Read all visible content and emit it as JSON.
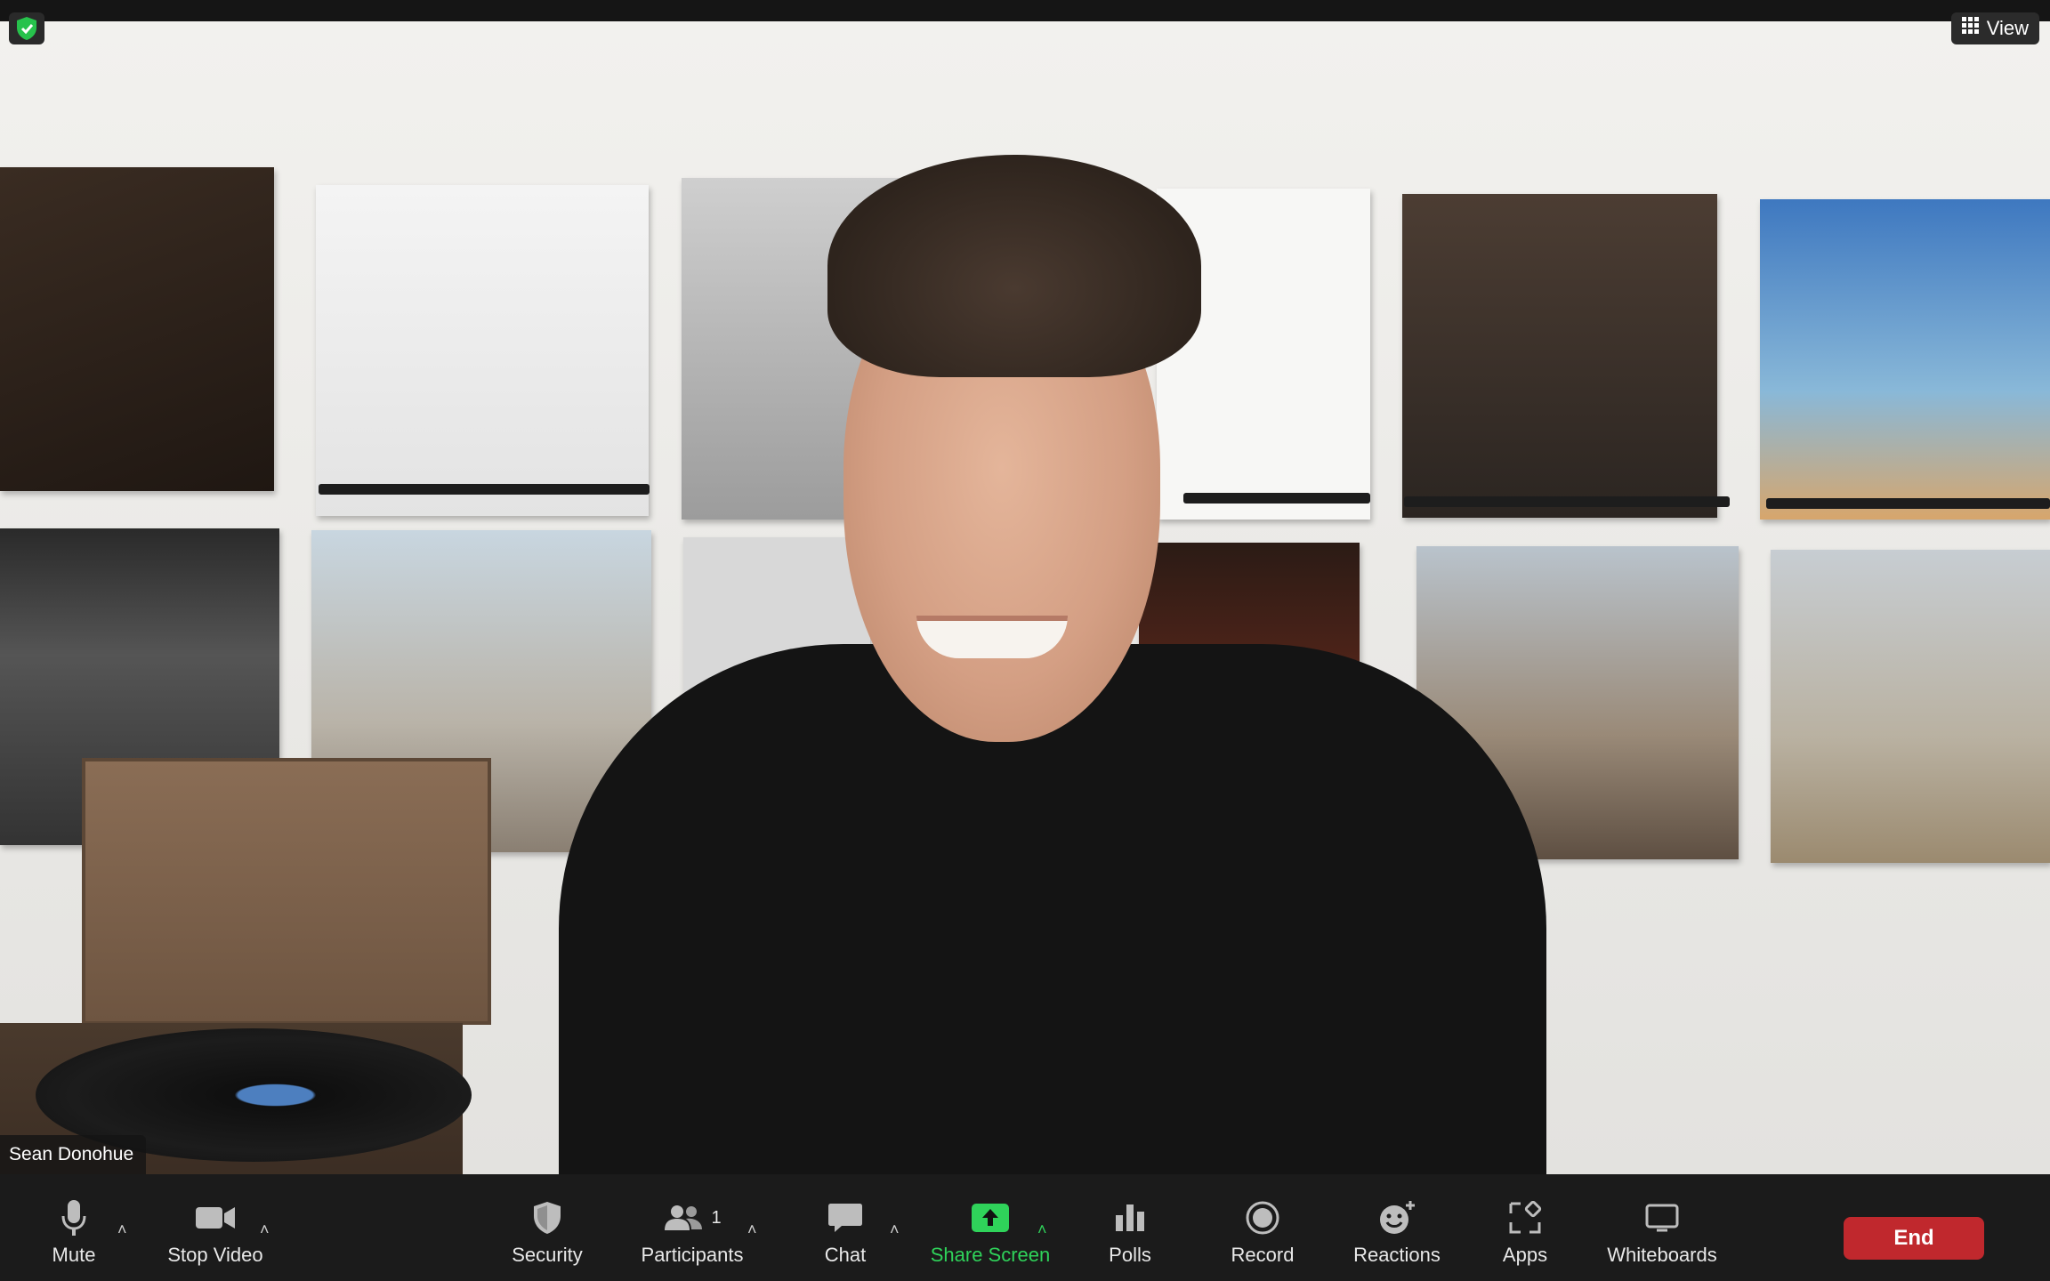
{
  "top": {
    "view_label": "View"
  },
  "video": {
    "participant_name": "Sean Donohue"
  },
  "toolbar": {
    "mute": "Mute",
    "stop_video": "Stop Video",
    "security": "Security",
    "participants": "Participants",
    "participants_count": "1",
    "chat": "Chat",
    "share_screen": "Share Screen",
    "polls": "Polls",
    "record": "Record",
    "reactions": "Reactions",
    "apps": "Apps",
    "whiteboards": "Whiteboards",
    "end": "End"
  },
  "colors": {
    "end_button": "#c0282d",
    "share_green": "#2fd35a",
    "toolbar_bg": "#1b1b1b"
  }
}
